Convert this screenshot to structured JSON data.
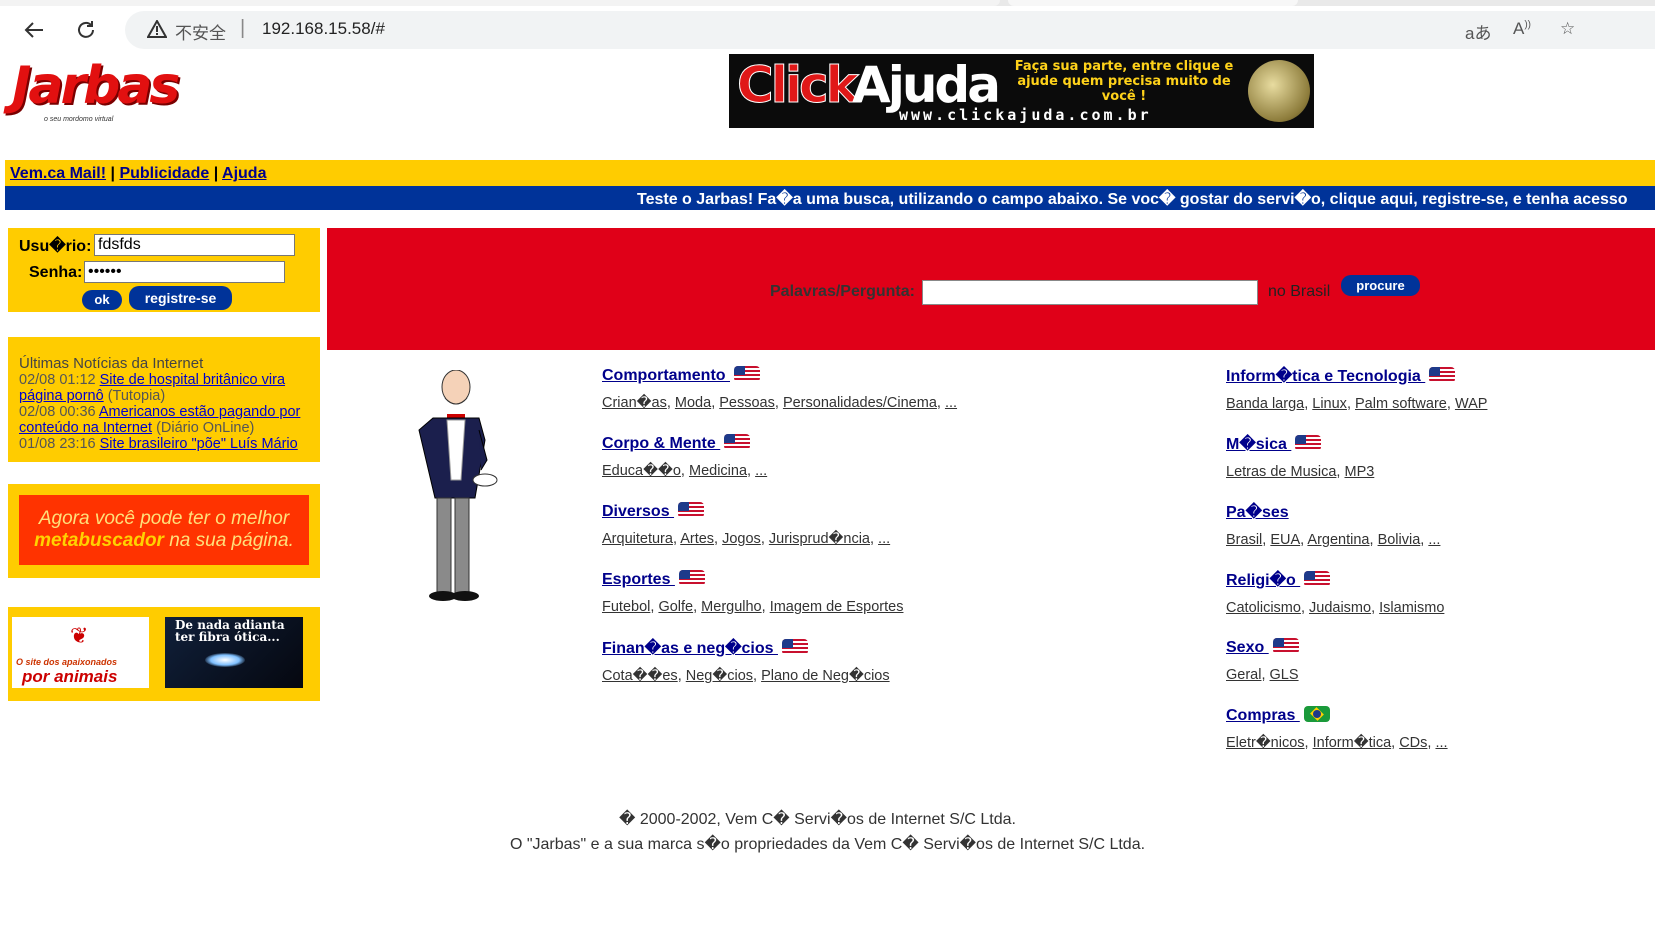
{
  "browser": {
    "security_label": "不安全",
    "url": "192.168.15.58/#"
  },
  "header": {
    "logo_text": "Jarbas",
    "logo_tagline": "o seu mordomo virtual",
    "banner": {
      "click": "Click",
      "ajuda": "Ajuda",
      "tagline": "Faça sua parte, entre clique e ajude quem precisa muito de você !",
      "site": "www.clickajuda.com.br"
    }
  },
  "topnav": {
    "mail": "Vem.ca Mail!",
    "sep1": "|",
    "publicidade": "Publicidade",
    "sep2": "|",
    "ajuda": "Ajuda"
  },
  "ticker": "Teste o Jarbas! Fa�a uma busca, utilizando o campo abaixo. Se voc� gostar do servi�o, clique aqui, registre-se, e tenha acesso",
  "login": {
    "user_label": "Usu�rio:",
    "user_value": "fdsfds",
    "pass_label": "Senha:",
    "pass_value": "••••••",
    "ok_label": "ok",
    "register_label": "registre-se"
  },
  "news": {
    "heading": "Últimas Notícias da Internet",
    "items": [
      {
        "time": "02/08 01:12",
        "link": "Site de hospital britânico vira página pornô",
        "source": "(Tutopia)"
      },
      {
        "time": "02/08 00:36",
        "link": "Americanos estão pagando por conteúdo na Internet",
        "source": "(Diário OnLine)"
      },
      {
        "time": "01/08 23:16",
        "link": "Site brasileiro \"põe\" Luís Mário",
        "source": ""
      }
    ]
  },
  "ads": {
    "meta_line1": "Agora você pode ter o melhor",
    "meta_bold": "metabuscador",
    "meta_line2": "na sua página.",
    "animais_small": "O site dos apaixonados",
    "animais_big": "por animais",
    "fibra": "De nada adianta ter fibra ótica..."
  },
  "search": {
    "label": "Palavras/Pergunta:",
    "value": "",
    "scope": "no Brasil",
    "button": "procure"
  },
  "directory": {
    "left": [
      {
        "title": "Comportamento ",
        "flag": "us-br",
        "subs": [
          "Crian�as",
          "Moda",
          "Pessoas",
          "Personalidades/Cinema",
          "..."
        ]
      },
      {
        "title": "Corpo & Mente ",
        "flag": "us-br",
        "subs": [
          "Educa��o",
          "Medicina",
          "..."
        ]
      },
      {
        "title": "Diversos ",
        "flag": "us-br",
        "subs": [
          "Arquitetura",
          "Artes",
          "Jogos",
          "Jurisprud�ncia",
          "..."
        ]
      },
      {
        "title": "Esportes ",
        "flag": "us-br",
        "subs": [
          "Futebol",
          "Golfe",
          "Mergulho",
          "Imagem de Esportes"
        ]
      },
      {
        "title": "Finan�as e neg�cios ",
        "flag": "us",
        "subs": [
          "Cota��es",
          "Neg�cios",
          "Plano de Neg�cios"
        ]
      }
    ],
    "right": [
      {
        "title": "Inform�tica e Tecnologia ",
        "flag": "us-br",
        "subs": [
          "Banda larga",
          "Linux",
          "Palm software",
          "WAP"
        ]
      },
      {
        "title": "M�sica ",
        "flag": "us-br",
        "subs": [
          "Letras de Musica",
          "MP3"
        ]
      },
      {
        "title": "Pa�ses ",
        "flag": "",
        "subs": [
          "Brasil",
          "EUA",
          "Argentina",
          "Bolivia",
          "..."
        ]
      },
      {
        "title": "Religi�o ",
        "flag": "us-br",
        "subs": [
          "Catolicismo",
          "Judaismo",
          "Islamismo"
        ]
      },
      {
        "title": "Sexo ",
        "flag": "us",
        "subs": [
          "Geral",
          "GLS"
        ]
      },
      {
        "title": "Compras ",
        "flag": "br",
        "subs": [
          "Eletr�nicos",
          "Inform�tica",
          "CDs",
          "..."
        ]
      }
    ]
  },
  "footer": {
    "line1": "� 2000-2002, Vem C� Servi�os de Internet S/C Ltda.",
    "line2": "O \"Jarbas\" e a sua marca s�o propriedades da Vem C� Servi�os de Internet S/C Ltda."
  }
}
